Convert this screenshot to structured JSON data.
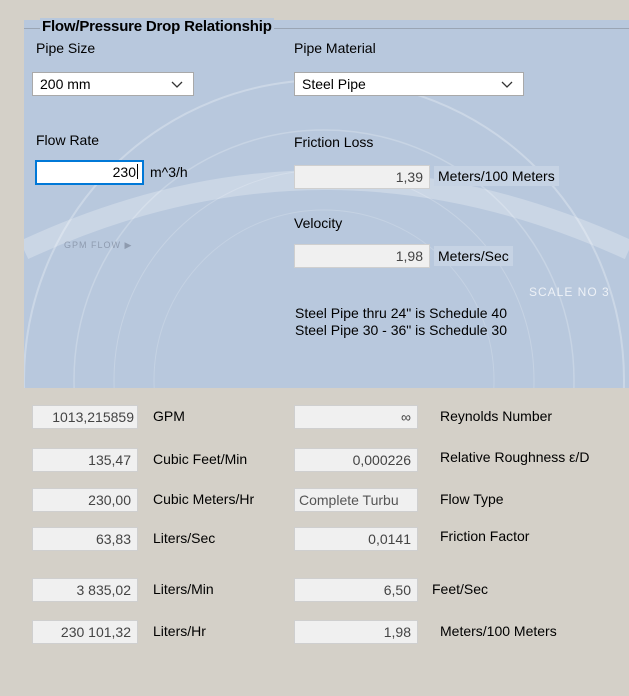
{
  "group": {
    "title": "Flow/Pressure Drop Relationship"
  },
  "pipe_size": {
    "label": "Pipe Size",
    "value": "200 mm"
  },
  "pipe_material": {
    "label": "Pipe Material",
    "value": "Steel Pipe"
  },
  "flow_rate": {
    "label": "Flow Rate",
    "value": "230",
    "unit": "m^3/h"
  },
  "friction_loss": {
    "label": "Friction Loss",
    "value": "1,39",
    "unit": "Meters/100 Meters"
  },
  "velocity": {
    "label": "Velocity",
    "value": "1,98",
    "unit": "Meters/Sec"
  },
  "notes": {
    "line1": "Steel Pipe thru 24\" is Schedule 40",
    "line2": "Steel Pipe 30 - 36\" is Schedule 30"
  },
  "watermark": {
    "gpm_flow": "GPM FLOW ▶",
    "scale": "SCALE NO 3"
  },
  "left_results": [
    {
      "value": "1013,215859",
      "unit": "GPM"
    },
    {
      "value": "135,47",
      "unit": "Cubic Feet/Min"
    },
    {
      "value": "230,00",
      "unit": "Cubic Meters/Hr"
    },
    {
      "value": "63,83",
      "unit": "Liters/Sec"
    },
    {
      "value": "3 835,02",
      "unit": "Liters/Min"
    },
    {
      "value": "230 101,32",
      "unit": "Liters/Hr"
    }
  ],
  "right_results": [
    {
      "value": "∞",
      "unit": "Reynolds Number"
    },
    {
      "value": "0,000226",
      "unit": "Relative Roughness ε/D"
    },
    {
      "value": "Complete Turbu",
      "unit": "Flow Type"
    },
    {
      "value": "0,0141",
      "unit": "Friction Factor"
    },
    {
      "value": "6,50",
      "unit": "Feet/Sec"
    },
    {
      "value": "1,98",
      "unit": "Meters/100 Meters"
    }
  ],
  "icons": {
    "dropdown": "chevron-down-icon"
  },
  "colors": {
    "panel": "#b8c8dd",
    "window": "#d4d0c8",
    "focus": "#0078d7"
  }
}
